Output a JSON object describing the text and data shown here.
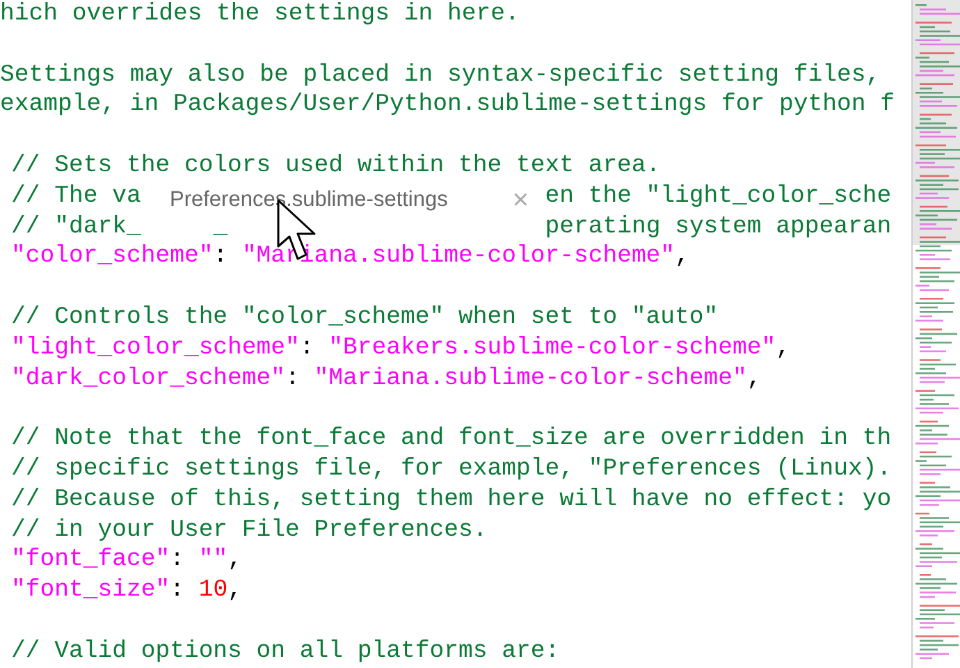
{
  "editor": {
    "lines": [
      {
        "kind": "header",
        "tokens": [
          {
            "kind": "comment",
            "text": "hich overrides the settings in here."
          }
        ]
      },
      {
        "kind": "blank"
      },
      {
        "kind": "header",
        "tokens": [
          {
            "kind": "comment",
            "text": "Settings may also be placed in syntax-specific setting files,"
          }
        ]
      },
      {
        "kind": "header",
        "tokens": [
          {
            "kind": "comment",
            "text": "example, in Packages/User/Python.sublime-settings for python f"
          }
        ]
      },
      {
        "kind": "blank"
      },
      {
        "kind": "code",
        "tokens": [
          {
            "kind": "comment",
            "text": "// Sets the colors used within the text area."
          }
        ]
      },
      {
        "kind": "code",
        "tokens": [
          {
            "kind": "comment",
            "text": "// The va                            en the \"light_color_sche"
          }
        ]
      },
      {
        "kind": "code",
        "tokens": [
          {
            "kind": "comment",
            "text": "// \"dark_     _                      perating system appearan"
          }
        ]
      },
      {
        "kind": "code",
        "tokens": [
          {
            "kind": "key",
            "text": "\"color_scheme\""
          },
          {
            "kind": "punct",
            "text": ": "
          },
          {
            "kind": "string",
            "text": "\"Mariana.sublime-color-scheme\""
          },
          {
            "kind": "punct",
            "text": ","
          }
        ]
      },
      {
        "kind": "blank"
      },
      {
        "kind": "code",
        "tokens": [
          {
            "kind": "comment",
            "text": "// Controls the \"color_scheme\" when set to \"auto\""
          }
        ]
      },
      {
        "kind": "code",
        "tokens": [
          {
            "kind": "key",
            "text": "\"light_color_scheme\""
          },
          {
            "kind": "punct",
            "text": ": "
          },
          {
            "kind": "string",
            "text": "\"Breakers.sublime-color-scheme\""
          },
          {
            "kind": "punct",
            "text": ","
          }
        ]
      },
      {
        "kind": "code",
        "tokens": [
          {
            "kind": "key",
            "text": "\"dark_color_scheme\""
          },
          {
            "kind": "punct",
            "text": ": "
          },
          {
            "kind": "string",
            "text": "\"Mariana.sublime-color-scheme\""
          },
          {
            "kind": "punct",
            "text": ","
          }
        ]
      },
      {
        "kind": "blank"
      },
      {
        "kind": "code",
        "tokens": [
          {
            "kind": "comment",
            "text": "// Note that the font_face and font_size are overridden in th"
          }
        ]
      },
      {
        "kind": "code",
        "tokens": [
          {
            "kind": "comment",
            "text": "// specific settings file, for example, \"Preferences (Linux)."
          }
        ]
      },
      {
        "kind": "code",
        "tokens": [
          {
            "kind": "comment",
            "text": "// Because of this, setting them here will have no effect: yo"
          }
        ]
      },
      {
        "kind": "code",
        "tokens": [
          {
            "kind": "comment",
            "text": "// in your User File Preferences."
          }
        ]
      },
      {
        "kind": "code",
        "tokens": [
          {
            "kind": "key",
            "text": "\"font_face\""
          },
          {
            "kind": "punct",
            "text": ": "
          },
          {
            "kind": "string",
            "text": "\"\""
          },
          {
            "kind": "punct",
            "text": ","
          }
        ]
      },
      {
        "kind": "code",
        "tokens": [
          {
            "kind": "key",
            "text": "\"font_size\""
          },
          {
            "kind": "punct",
            "text": ": "
          },
          {
            "kind": "number",
            "text": "10"
          },
          {
            "kind": "punct",
            "text": ","
          }
        ]
      },
      {
        "kind": "blank"
      },
      {
        "kind": "code",
        "tokens": [
          {
            "kind": "comment",
            "text": "// Valid options on all platforms are:"
          }
        ]
      }
    ]
  },
  "dragged_tab": {
    "title": "Preferences.sublime-settings",
    "close": "×"
  }
}
